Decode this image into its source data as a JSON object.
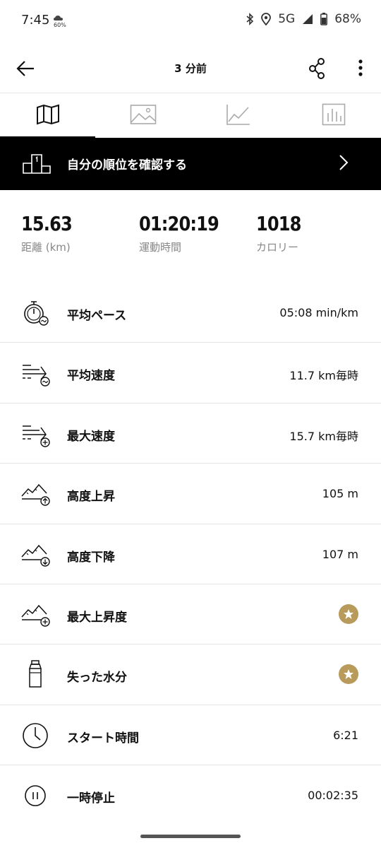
{
  "status_bar": {
    "time": "7:45",
    "weather_pct": "60%",
    "network": "5G",
    "battery": "68%"
  },
  "app_bar": {
    "title": "3 分前",
    "back_icon": "arrow-left-icon",
    "share_icon": "share-icon",
    "more_icon": "more-vertical-icon"
  },
  "tabs": [
    {
      "icon": "map-icon",
      "active": true
    },
    {
      "icon": "photo-icon",
      "active": false
    },
    {
      "icon": "line-chart-icon",
      "active": false
    },
    {
      "icon": "bar-chart-icon",
      "active": false
    }
  ],
  "banner": {
    "label": "自分の順位を確認する",
    "icon": "podium-icon"
  },
  "summary": [
    {
      "value": "15.63",
      "label": "距離 (km)"
    },
    {
      "value": "01:20:19",
      "label": "運動時間"
    },
    {
      "value": "1018",
      "label": "カロリー"
    }
  ],
  "rows": [
    {
      "label": "平均ペース",
      "value": "05:08 min/km",
      "icon": "stopwatch-pace-icon"
    },
    {
      "label": "平均速度",
      "value": "11.7 km毎時",
      "icon": "speed-average-icon"
    },
    {
      "label": "最大速度",
      "value": "15.7 km毎時",
      "icon": "speed-max-icon"
    },
    {
      "label": "高度上昇",
      "value": "105 m",
      "icon": "elevation-gain-icon"
    },
    {
      "label": "高度下降",
      "value": "107 m",
      "icon": "elevation-loss-icon"
    },
    {
      "label": "最大上昇度",
      "value": "",
      "premium": true,
      "icon": "elevation-max-icon"
    },
    {
      "label": "失った水分",
      "value": "",
      "premium": true,
      "icon": "water-bottle-icon"
    },
    {
      "label": "スタート時間",
      "value": "6:21",
      "icon": "clock-icon"
    },
    {
      "label": "一時停止",
      "value": "00:02:35",
      "icon": "pause-icon"
    }
  ],
  "colors": {
    "premium_badge": "#b89a5a",
    "banner_bg": "#000000"
  }
}
